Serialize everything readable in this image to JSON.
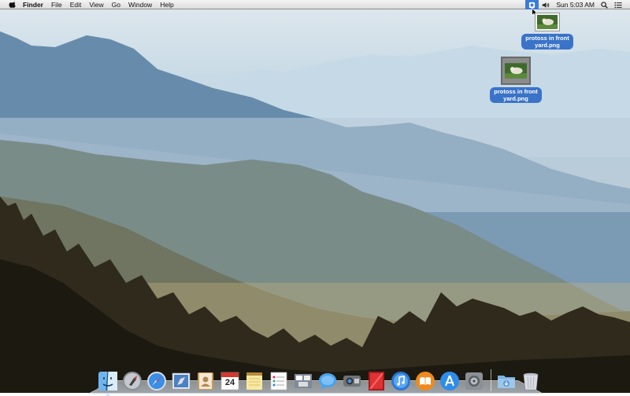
{
  "menubar": {
    "app_name": "Finder",
    "menus": [
      "File",
      "Edit",
      "View",
      "Go",
      "Window",
      "Help"
    ],
    "clock": "Sun 5:03 AM"
  },
  "desktop_icons": [
    {
      "label_line1": "protoss in front",
      "label_line2": "yard.png"
    },
    {
      "label_line1": "protoss in front",
      "label_line2": "yard.png"
    }
  ],
  "dock": {
    "apps": [
      "finder",
      "launchpad",
      "safari",
      "mail",
      "contacts",
      "calendar",
      "notes",
      "reminders",
      "mission-control",
      "messages",
      "facetime",
      "photo-booth",
      "itunes",
      "ibooks",
      "app-store",
      "system-preferences"
    ],
    "others": [
      "downloads-stack",
      "trash"
    ],
    "calendar_day": "24"
  }
}
